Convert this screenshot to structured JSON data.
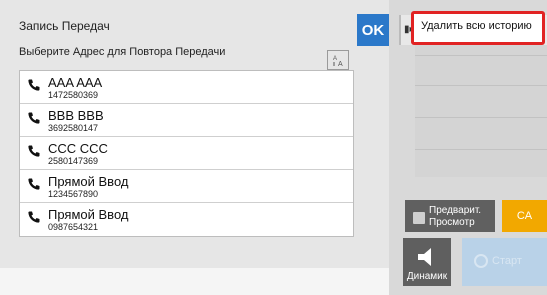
{
  "left_panel": {
    "title": "Запись Передач",
    "subtitle": "Выберите Адрес для Повтора Передачи",
    "ok_label": "OK",
    "sort_icon": "sort-az-icon",
    "contacts": [
      {
        "name": "AAA AAA",
        "number": "1472580369"
      },
      {
        "name": "BBB BBB",
        "number": "3692580147"
      },
      {
        "name": "CCC CCC",
        "number": "2580147369"
      },
      {
        "name": "Прямой Ввод",
        "number": "1234567890"
      },
      {
        "name": "Прямой Ввод",
        "number": "0987654321"
      }
    ]
  },
  "right_panel": {
    "menu_item": "Удалить всю историю",
    "preview_label_line1": "Предварит.",
    "preview_label_line2": "Просмотр",
    "ca_label": "CA",
    "speaker_label": "Динамик",
    "dimmed_label": "Старт"
  },
  "colors": {
    "ok_blue": "#2b78c9",
    "ca_orange": "#f2a800",
    "highlight_red": "#e12323"
  }
}
